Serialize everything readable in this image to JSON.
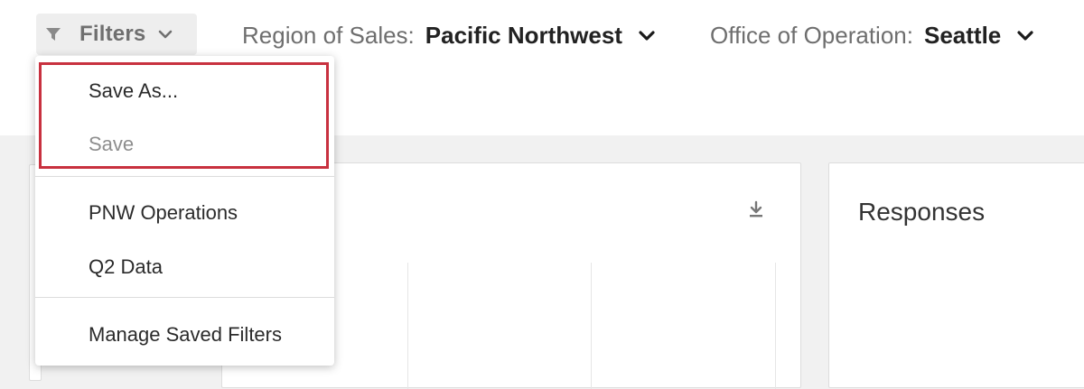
{
  "filters_button": {
    "label": "Filters",
    "icon": "funnel-icon"
  },
  "region_filter": {
    "key": "Region of Sales:",
    "value": "Pacific Northwest"
  },
  "office_filter": {
    "key": "Office of Operation:",
    "value": "Seattle"
  },
  "responses_card": {
    "title": "Responses"
  },
  "menu": {
    "save_as": "Save As...",
    "save": "Save",
    "saved_filters": [
      "PNW Operations",
      "Q2 Data"
    ],
    "manage": "Manage Saved Filters"
  },
  "colors": {
    "highlight": "#c8313f",
    "page_bg": "#f1f1f1",
    "button_bg": "#eeeeee"
  }
}
